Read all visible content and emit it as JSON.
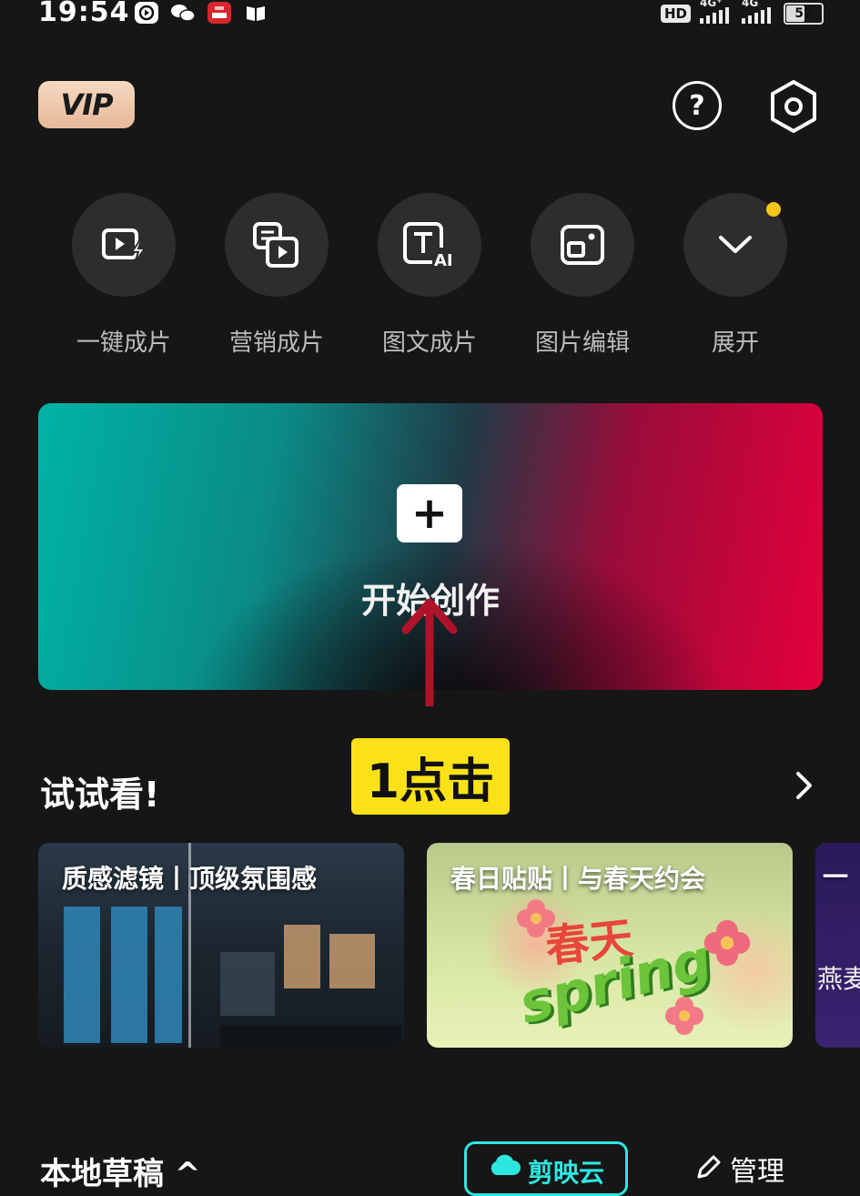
{
  "status_bar": {
    "time": "19:54",
    "hd_label": "HD",
    "network_1": "4G⁺",
    "network_2": "4G",
    "battery": "52"
  },
  "header": {
    "vip_label": "VIP",
    "help_icon": "question-circle-icon",
    "settings_icon": "hexagon-gear-icon"
  },
  "tools": [
    {
      "label": "一键成片",
      "icon": "video-flash-icon"
    },
    {
      "label": "营销成片",
      "icon": "marketing-video-icon"
    },
    {
      "label": "图文成片",
      "icon": "text-ai-icon"
    },
    {
      "label": "图片编辑",
      "icon": "image-edit-icon"
    },
    {
      "label": "展开",
      "icon": "chevron-down-icon"
    }
  ],
  "banner": {
    "plus": "+",
    "title": "开始创作"
  },
  "annotation": {
    "label": "1点击",
    "color": "#fbe218",
    "arrow_color": "#b0122a"
  },
  "try_section": {
    "title": "试试看!",
    "cards": [
      {
        "title": "质感滤镜丨顶级氛围感"
      },
      {
        "title": "春日贴贴丨与春天约会",
        "art_text_1": "春天",
        "art_text_2": "spring"
      },
      {
        "title": "一",
        "subtitle": "燕麦"
      }
    ]
  },
  "drafts": {
    "title": "本地草稿 ^",
    "cloud_label": "剪映云",
    "manage_label": "管理"
  },
  "colors": {
    "background": "#161616",
    "accent_cyan": "#2ee6e0",
    "notification_dot": "#f5c518"
  }
}
